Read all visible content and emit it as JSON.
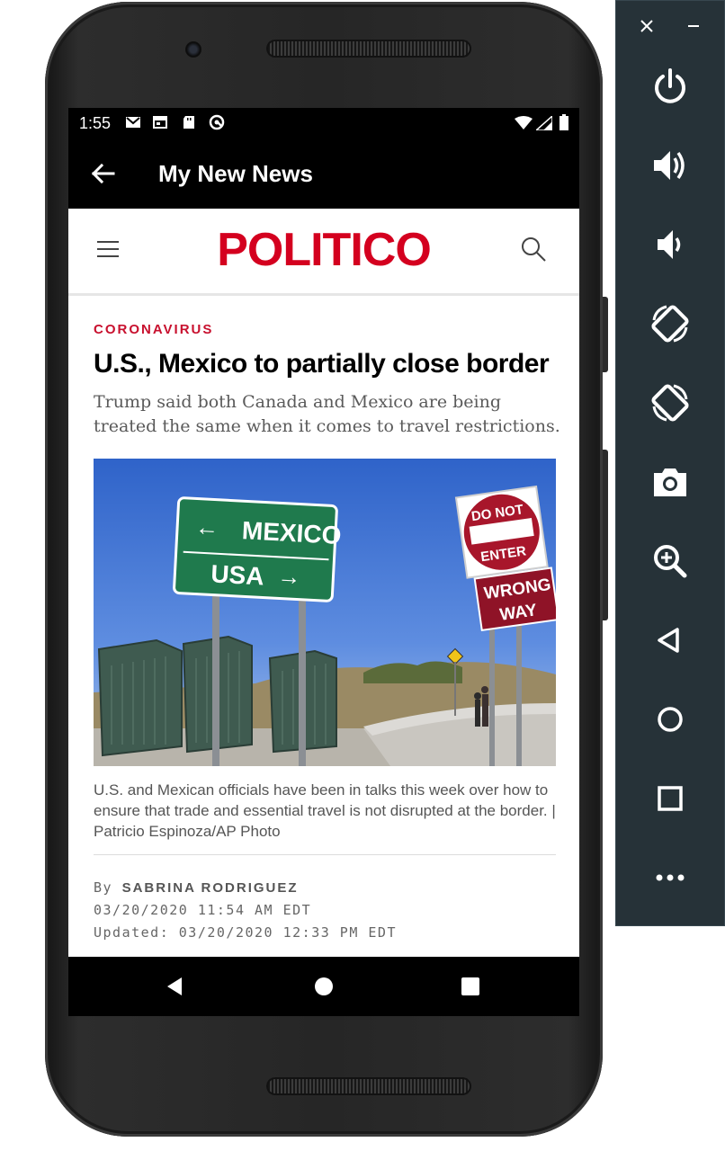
{
  "status_bar": {
    "time": "1:55",
    "left_icons": [
      "gmail-icon",
      "calendar-icon",
      "sd-card-icon",
      "sync-icon"
    ],
    "right_icons": [
      "wifi-icon",
      "cell-signal-icon",
      "battery-icon"
    ]
  },
  "app_bar": {
    "title": "My New News",
    "back_icon": "arrow-left-icon"
  },
  "site_header": {
    "logo_text": "POLITICO",
    "brand_color": "#d4001f",
    "menu_icon": "hamburger-icon",
    "search_icon": "search-icon"
  },
  "article": {
    "kicker": "CORONAVIRUS",
    "headline": "U.S., Mexico to partially close border",
    "dek": "Trump said both Canada and Mexico are being treated the same when it comes to travel restrictions.",
    "photo": {
      "sign_mexico": "MEXICO",
      "sign_usa": "USA",
      "sign_do_not": "DO NOT",
      "sign_enter": "ENTER",
      "sign_wrong": "WRONG",
      "sign_way": "WAY"
    },
    "caption": "U.S. and Mexican officials have been in talks this week over how to ensure that trade and essential travel is not disrupted at the border. | Patricio Espinoza/AP Photo",
    "byline_prefix": "By",
    "author": "SABRINA RODRIGUEZ",
    "published": "03/20/2020 11:54 AM EDT",
    "updated": "Updated: 03/20/2020 12:33 PM EDT"
  },
  "nav_bar": {
    "buttons": [
      "back-triangle-icon",
      "home-circle-icon",
      "recents-square-icon"
    ]
  },
  "emulator_toolbar": {
    "close": "close-icon",
    "minimize": "minimize-icon",
    "buttons": [
      "power-icon",
      "volume-up-icon",
      "volume-down-icon",
      "rotate-left-icon",
      "rotate-right-icon",
      "camera-icon",
      "zoom-icon",
      "back-icon",
      "home-icon",
      "overview-icon",
      "more-icon"
    ]
  }
}
